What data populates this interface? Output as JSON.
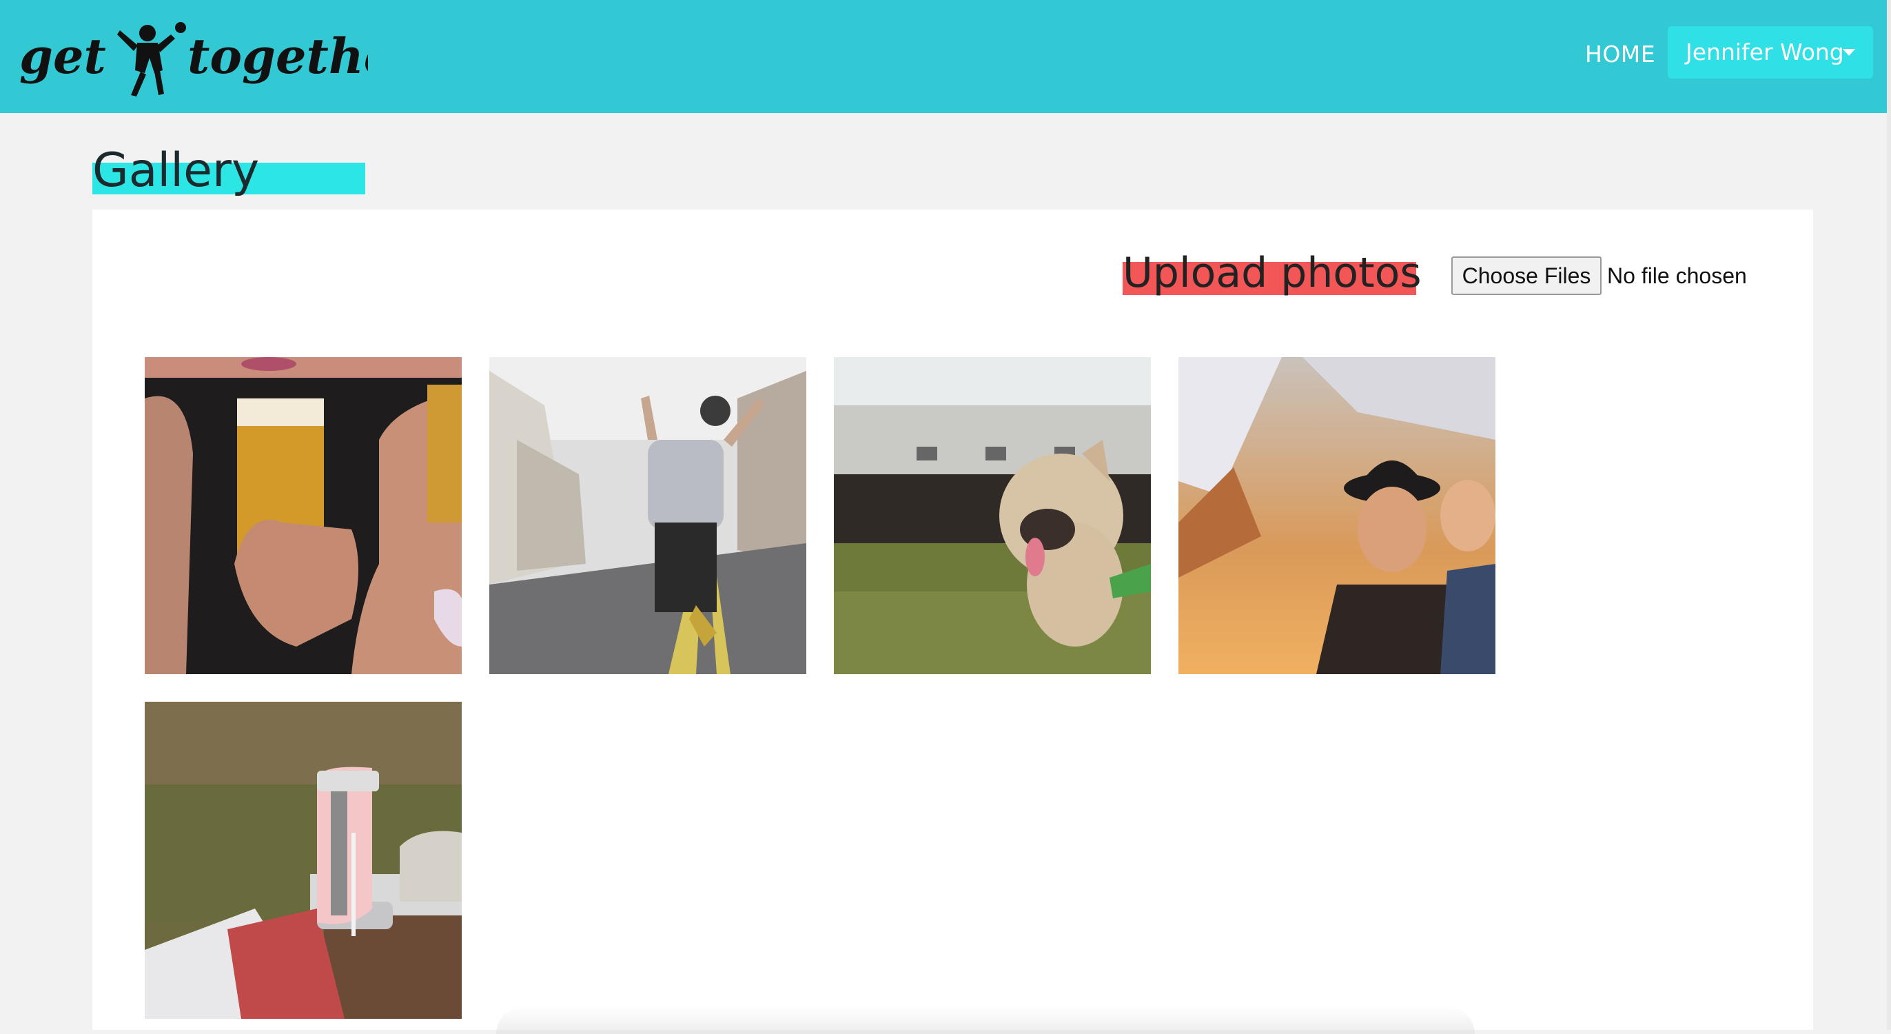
{
  "app": {
    "logo_text": "get together"
  },
  "nav": {
    "home_label": "HOME",
    "user_name": "Jennifer Wong",
    "user_dropdown_icon": "caret-down-icon"
  },
  "page": {
    "title": "Gallery",
    "upload_title": "Upload photos",
    "file_input": {
      "button_label": "Choose Files",
      "status": "No file chosen"
    }
  },
  "colors": {
    "navbar": "#33c9d4",
    "user_button": "#2fe0e6",
    "title_highlight": "#2ce6e6",
    "upload_highlight": "#f25656",
    "page_background": "#f2f2f2"
  },
  "photos": [
    {
      "subject": "woman holding glass of beer"
    },
    {
      "subject": "person jumping on street"
    },
    {
      "subject": "french bulldog on grass"
    },
    {
      "subject": "two women laughing"
    },
    {
      "subject": "picnic with pitcher and plates"
    }
  ]
}
